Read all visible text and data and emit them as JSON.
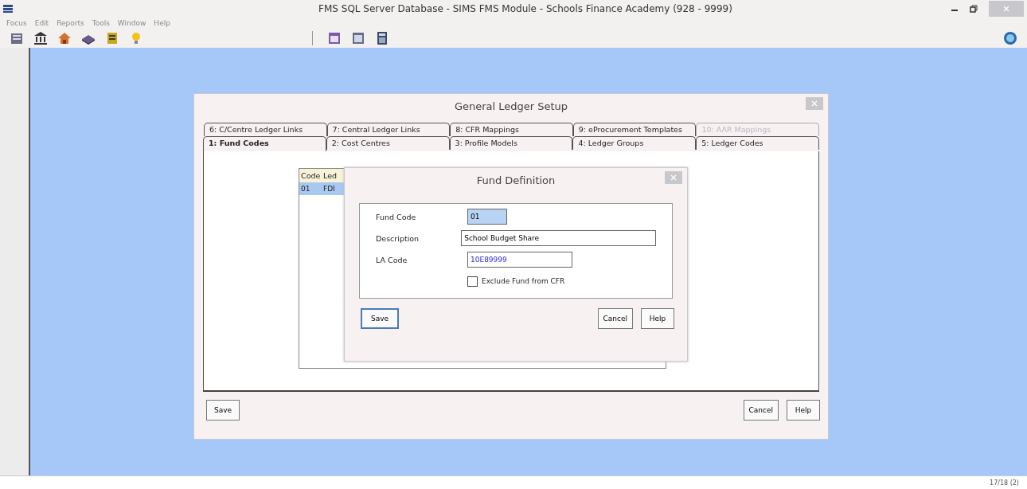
{
  "window": {
    "title": "FMS SQL Server Database - SIMS FMS Module - Schools Finance Academy (928 - 9999)"
  },
  "menu": [
    "Focus",
    "Edit",
    "Reports",
    "Tools",
    "Window",
    "Help"
  ],
  "dialog": {
    "title": "General Ledger Setup",
    "tab_rows": [
      {
        "tabs": [
          {
            "label": "6: C/Centre Ledger Links",
            "selected": false,
            "disabled": false
          },
          {
            "label": "7: Central Ledger Links",
            "selected": false,
            "disabled": false
          },
          {
            "label": "8: CFR Mappings",
            "selected": false,
            "disabled": false
          },
          {
            "label": "9: eProcurement Templates",
            "selected": false,
            "disabled": false
          },
          {
            "label": "10: AAR Mappings",
            "selected": false,
            "disabled": true
          }
        ]
      },
      {
        "tabs": [
          {
            "label": "1: Fund Codes",
            "selected": true,
            "disabled": false
          },
          {
            "label": "2: Cost Centres",
            "selected": false,
            "disabled": false
          },
          {
            "label": "3: Profile Models",
            "selected": false,
            "disabled": false
          },
          {
            "label": "4: Ledger Groups",
            "selected": false,
            "disabled": false
          },
          {
            "label": "5: Ledger Codes",
            "selected": false,
            "disabled": false
          }
        ]
      }
    ],
    "list": {
      "columns": [
        "Code",
        "Led"
      ],
      "rows": [
        {
          "cells": [
            "01",
            "FDI"
          ],
          "selected": true
        }
      ]
    },
    "buttons": {
      "left": [
        {
          "label": "Save"
        }
      ],
      "right": [
        {
          "label": "Cancel"
        },
        {
          "label": "Help"
        }
      ]
    }
  },
  "fund_definition": {
    "title": "Fund Definition",
    "fields": [
      {
        "label": "Fund Code",
        "value": "01",
        "selected": true
      },
      {
        "label": "Description",
        "value": "School Budget Share",
        "selected": false
      },
      {
        "label": "LA Code",
        "value": "10E89999",
        "selected": false
      }
    ],
    "checkbox": {
      "label": "Exclude Fund from CFR",
      "checked": false
    },
    "buttons": {
      "left": [
        {
          "label": "Save",
          "default": true
        }
      ],
      "right": [
        {
          "label": "Cancel",
          "default": false
        },
        {
          "label": "Help",
          "default": false
        }
      ]
    }
  },
  "status_bar": {
    "text": "17/18 (2)"
  }
}
